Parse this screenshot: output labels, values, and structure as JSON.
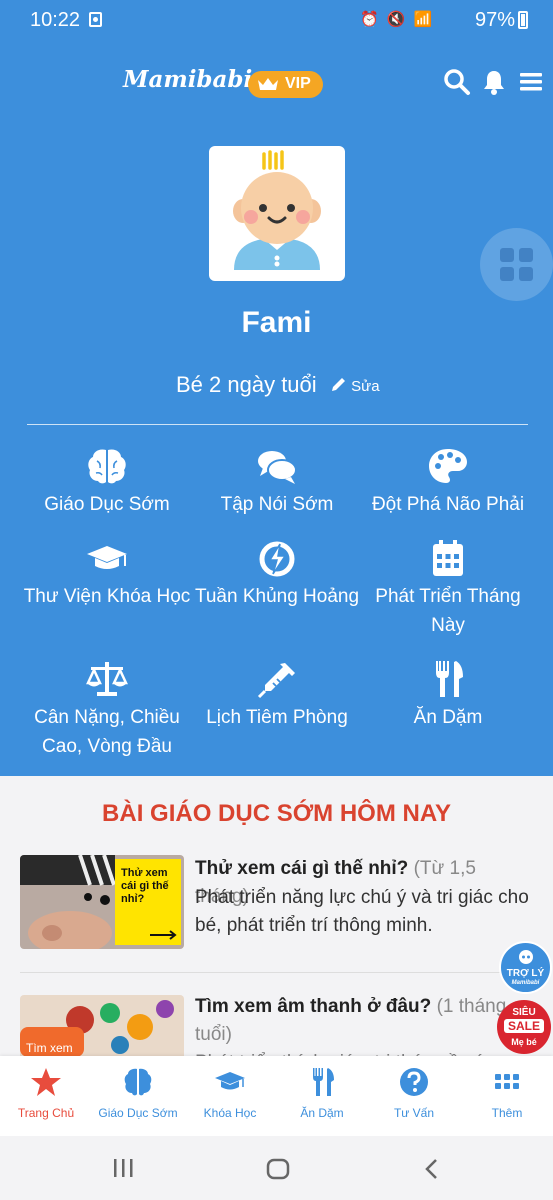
{
  "status_bar": {
    "time": "10:22",
    "battery": "97%",
    "icons": "⏰ 🔇 📶"
  },
  "header": {
    "logo": "Mamibabi",
    "vip_label": "VIP"
  },
  "profile": {
    "name": "Fami",
    "age_text": "Bé 2 ngày tuổi",
    "edit_label": "Sửa"
  },
  "features": [
    {
      "label": "Giáo Dục Sớm",
      "icon": "brain-icon"
    },
    {
      "label": "Tập Nói Sớm",
      "icon": "chat-bubbles-icon"
    },
    {
      "label": "Đột Phá Não Phải",
      "icon": "palette-icon"
    },
    {
      "label": "Thư Viện Khóa Học",
      "icon": "graduation-cap-icon"
    },
    {
      "label": "Tuần Khủng Hoảng",
      "icon": "crisis-icon"
    },
    {
      "label": "Phát Triển Tháng Này",
      "icon": "calendar-icon"
    },
    {
      "label": "Cân Nặng, Chiều Cao, Vòng Đầu",
      "icon": "scale-icon"
    },
    {
      "label": "Lịch Tiêm Phòng",
      "icon": "syringe-icon"
    },
    {
      "label": "Ăn Dặm",
      "icon": "utensils-icon"
    }
  ],
  "section": {
    "title": "BÀI GIÁO DỤC SỚM HÔM NAY"
  },
  "articles": [
    {
      "title": "Thử xem cái gì thế nhỉ?",
      "age": "(Từ 1,5 tháng)",
      "description": "Phát triển năng lực chú ý và tri giác cho bé, phát triển trí thông minh.",
      "thumb_text": "Thử xem cái gì thế nhỉ?"
    },
    {
      "title": "Tìm xem âm thanh ở đâu?",
      "age": "(1 tháng tuổi)",
      "description": "Phát triển thính giác, tri thức về các",
      "thumb_text": "Tìm xem"
    }
  ],
  "floating": {
    "assistant_line1": "TRỢ LÝ",
    "assistant_line2": "Mamibabi",
    "sale_line1": "SIÊU",
    "sale_line2": "SALE",
    "sale_line3": "Mẹ bé"
  },
  "bottom_nav": [
    {
      "label": "Trang Chủ",
      "icon": "star-icon",
      "active": true
    },
    {
      "label": "Giáo Dục Sớm",
      "icon": "brain-icon"
    },
    {
      "label": "Khóa Học",
      "icon": "graduation-cap-icon"
    },
    {
      "label": "Ăn Dặm",
      "icon": "utensils-icon"
    },
    {
      "label": "Tư Vấn",
      "icon": "question-icon"
    },
    {
      "label": "Thêm",
      "icon": "grid-icon"
    }
  ],
  "colors": {
    "primary": "#3d8fdc",
    "accent": "#e84c3d",
    "vip": "#f5a623",
    "title_red": "#d9432f"
  }
}
